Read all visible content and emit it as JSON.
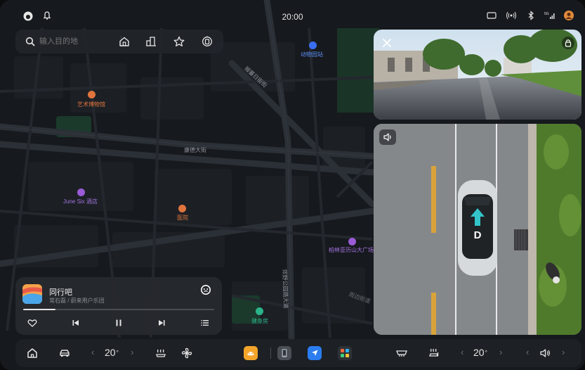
{
  "status_bar": {
    "time": "20:00",
    "left_icons": [
      "app-logo-icon",
      "bell-icon"
    ],
    "right_icons": [
      "cast-icon",
      "signal-wave-icon",
      "bluetooth-icon",
      "cellular-5g-icon",
      "avatar-icon"
    ]
  },
  "search": {
    "placeholder": "输入目的地",
    "shortcuts": [
      "home-icon",
      "company-icon",
      "star-icon",
      "gas-station-icon"
    ]
  },
  "map": {
    "roads": [
      "猴蕃日街街",
      "康德大街",
      "郊野公园路大道"
    ],
    "pois": [
      {
        "label": "动物园站",
        "icon": "metro-icon",
        "color": "#3a6ef0"
      },
      {
        "label": "艺术博物馆",
        "icon": "museum-icon",
        "color": "#e0743d"
      },
      {
        "label": "June Six 酒店",
        "icon": "hotel-icon",
        "color": "#9a5bd6"
      },
      {
        "label": "医院",
        "icon": "hospital-icon",
        "color": "#e0743d"
      },
      {
        "label": "柏林亚历山大广场",
        "icon": "landmark-icon",
        "color": "#9a5bd6"
      },
      {
        "label": "健身房",
        "icon": "gym-icon",
        "color": "#2bb38a"
      },
      {
        "label": "周边街道",
        "icon": "",
        "color": "#6b6f75"
      }
    ]
  },
  "camera": {
    "front_icons": [
      "close-icon",
      "lock-icon"
    ],
    "surround_gear": "D",
    "surround_icons": [
      "volume-icon"
    ]
  },
  "music": {
    "title": "同行吧",
    "artist": "常石磊 / 蔚来用户乐团",
    "progress": 0.17,
    "controls": [
      "heart-icon",
      "previous-icon",
      "pause-icon",
      "next-icon",
      "playlist-icon"
    ]
  },
  "dock": {
    "left_temp": "20",
    "right_temp": "20",
    "temp_unit": "°",
    "icons": [
      "home-icon",
      "car-icon",
      "seat-heat-icon",
      "fan-icon",
      "rear-defrost-icon",
      "seat-heat-right-icon",
      "volume-icon"
    ],
    "apps": [
      {
        "name": "assistant-app-icon",
        "color": "#f2a52a"
      },
      {
        "name": "phone-app-icon",
        "color": "#4a4e55"
      },
      {
        "name": "navigation-app-icon",
        "color": "#2b7df0"
      },
      {
        "name": "apps-grid-icon",
        "color": "#3a3d42"
      }
    ]
  }
}
